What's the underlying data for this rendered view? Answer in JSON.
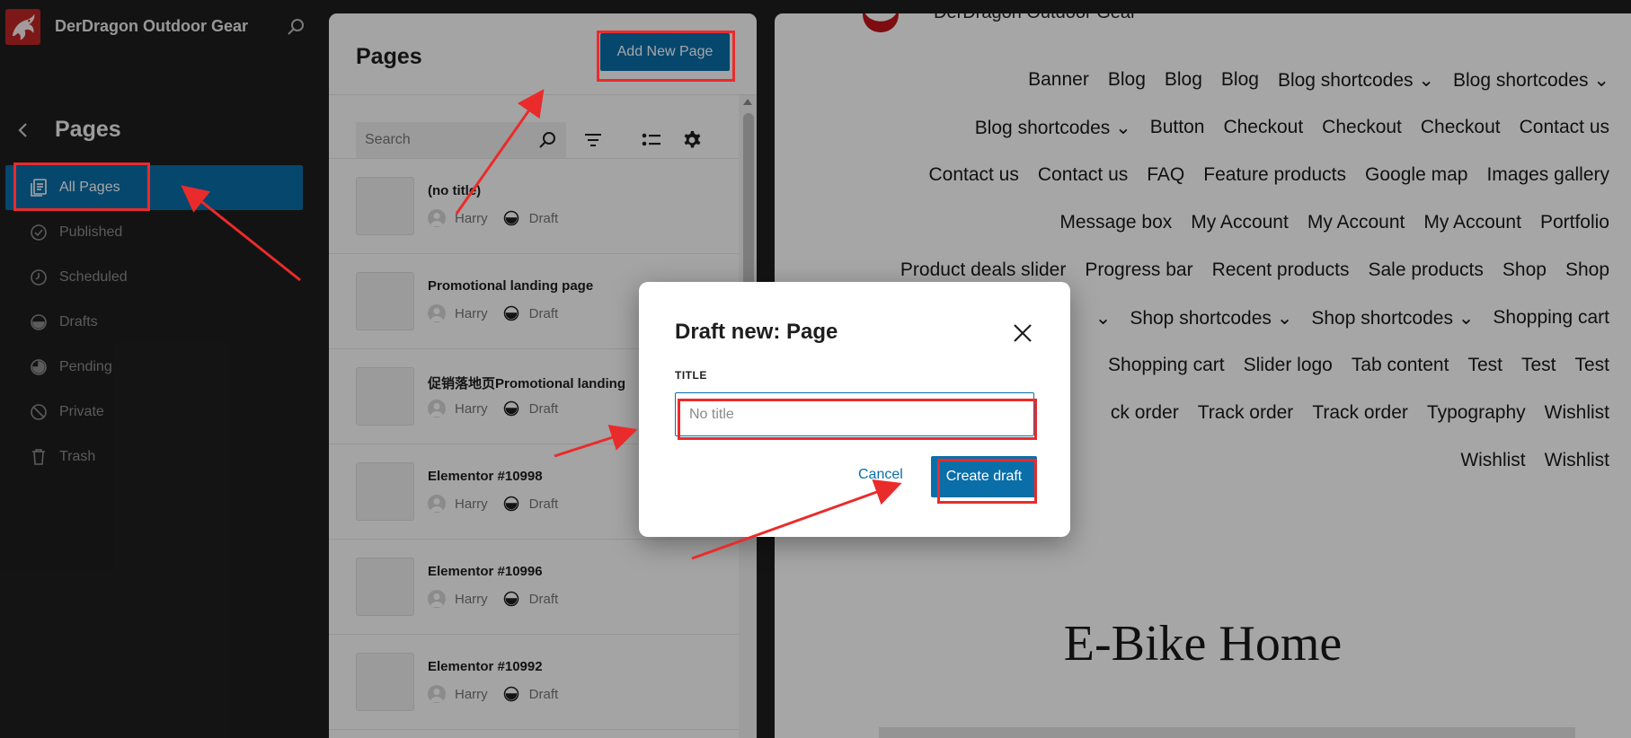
{
  "site": {
    "name": "DerDragon Outdoor Gear"
  },
  "sidebar": {
    "section_title": "Pages",
    "items": [
      {
        "label": "All Pages",
        "icon": "pages-icon",
        "active": true
      },
      {
        "label": "Published",
        "icon": "published-icon"
      },
      {
        "label": "Scheduled",
        "icon": "scheduled-icon"
      },
      {
        "label": "Drafts",
        "icon": "drafts-icon"
      },
      {
        "label": "Pending",
        "icon": "pending-icon"
      },
      {
        "label": "Private",
        "icon": "private-icon"
      },
      {
        "label": "Trash",
        "icon": "trash-icon"
      }
    ]
  },
  "pages_panel": {
    "title": "Pages",
    "add_button": "Add New Page",
    "search_placeholder": "Search",
    "pages": [
      {
        "title": "(no title)",
        "author": "Harry",
        "status": "Draft"
      },
      {
        "title": "Promotional landing page",
        "author": "Harry",
        "status": "Draft"
      },
      {
        "title": "促销落地页Promotional landing",
        "author": "Harry",
        "status": "Draft"
      },
      {
        "title": "Elementor #10998",
        "author": "Harry",
        "status": "Draft"
      },
      {
        "title": "Elementor #10996",
        "author": "Harry",
        "status": "Draft"
      },
      {
        "title": "Elementor #10992",
        "author": "Harry",
        "status": "Draft"
      }
    ]
  },
  "preview": {
    "brand": "DerDragon Outdoor Gear",
    "menu_lines": [
      [
        "Banner",
        "Blog",
        "Blog",
        "Blog",
        "Blog shortcodes ⌄",
        "Blog shortcodes ⌄"
      ],
      [
        "Blog shortcodes ⌄",
        "Button",
        "Checkout",
        "Checkout",
        "Checkout",
        "Contact us"
      ],
      [
        "Contact us",
        "Contact us",
        "FAQ",
        "Feature products",
        "Google map",
        "Images gallery"
      ],
      [
        "Message box",
        "My Account",
        "My Account",
        "My Account",
        "Portfolio"
      ],
      [
        "Product deals slider",
        "Progress bar",
        "Recent products",
        "Sale products",
        "Shop",
        "Shop"
      ],
      [
        "⌄",
        "Shop shortcodes ⌄",
        "Shop shortcodes ⌄",
        "Shopping cart"
      ],
      [
        "Shopping cart",
        "Slider logo",
        "Tab content",
        "Test",
        "Test",
        "Test"
      ],
      [
        "ck order",
        "Track order",
        "Track order",
        "Typography",
        "Wishlist"
      ],
      [
        "Wishlist",
        "Wishlist"
      ]
    ],
    "heading": "E-Bike Home"
  },
  "modal": {
    "title": "Draft new: Page",
    "field_label": "TITLE",
    "input_placeholder": "No title",
    "input_value": "",
    "cancel": "Cancel",
    "create": "Create draft"
  },
  "colors": {
    "accent": "#0a6ea9",
    "annotation": "#ea2b2b",
    "sidebar_bg": "#1e1e1e"
  }
}
